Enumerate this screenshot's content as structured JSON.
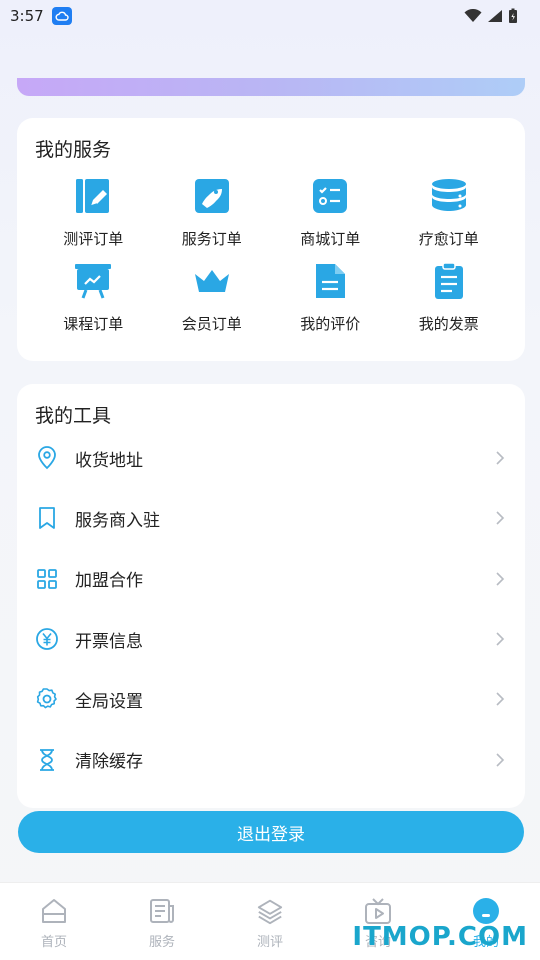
{
  "status_bar": {
    "time": "3:57"
  },
  "services": {
    "title": "我的服务",
    "items": [
      {
        "label": "测评订单",
        "icon": "assessment-icon"
      },
      {
        "label": "服务订单",
        "icon": "service-order-icon"
      },
      {
        "label": "商城订单",
        "icon": "mall-order-icon"
      },
      {
        "label": "疗愈订单",
        "icon": "healing-order-icon"
      },
      {
        "label": "课程订单",
        "icon": "course-order-icon"
      },
      {
        "label": "会员订单",
        "icon": "crown-icon"
      },
      {
        "label": "我的评价",
        "icon": "review-icon"
      },
      {
        "label": "我的发票",
        "icon": "invoice-icon"
      }
    ]
  },
  "tools": {
    "title": "我的工具",
    "items": [
      {
        "label": "收货地址",
        "icon": "location-pin-icon"
      },
      {
        "label": "服务商入驻",
        "icon": "bookmark-icon"
      },
      {
        "label": "加盟合作",
        "icon": "grid-icon"
      },
      {
        "label": "开票信息",
        "icon": "yuan-icon"
      },
      {
        "label": "全局设置",
        "icon": "gear-icon"
      },
      {
        "label": "清除缓存",
        "icon": "hourglass-icon"
      }
    ]
  },
  "logout_label": "退出登录",
  "tabbar": {
    "tabs": [
      {
        "label": "首页",
        "icon": "home-icon",
        "active": false
      },
      {
        "label": "服务",
        "icon": "news-icon",
        "active": false
      },
      {
        "label": "测评",
        "icon": "layers-icon",
        "active": false
      },
      {
        "label": "咨询",
        "icon": "tv-icon",
        "active": false
      },
      {
        "label": "我的",
        "icon": "profile-icon",
        "active": true
      }
    ]
  },
  "watermark": "ITMOP.COM",
  "colors": {
    "accent": "#2ab0e8",
    "icon_blue": "#2aa7e4",
    "tab_inactive": "#aeb3bb"
  }
}
